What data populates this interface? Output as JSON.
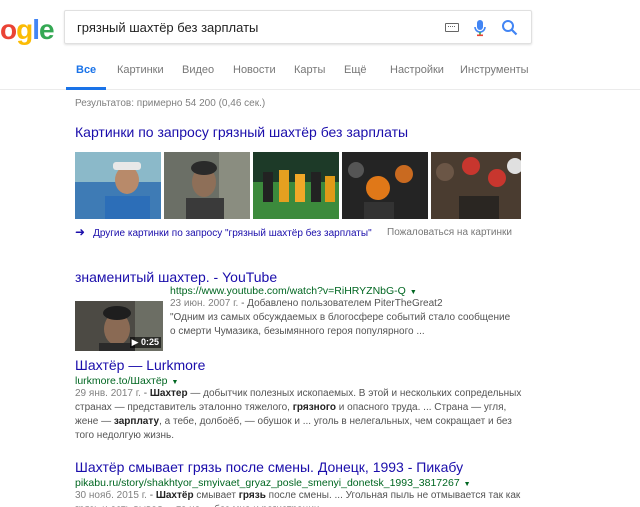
{
  "logo": {
    "letters": [
      "o",
      "g",
      "l",
      "e"
    ],
    "colors": [
      "#EA4335",
      "#FBBC05",
      "#4285F4",
      "#34A853"
    ]
  },
  "search": {
    "query": "грязный шахтёр без зарплаты"
  },
  "tabs": [
    {
      "label": "Все",
      "active": true
    },
    {
      "label": "Картинки"
    },
    {
      "label": "Видео"
    },
    {
      "label": "Новости"
    },
    {
      "label": "Карты"
    },
    {
      "label": "Ещё"
    },
    {
      "label": "Настройки"
    },
    {
      "label": "Инструменты"
    }
  ],
  "stats": "Результатов: примерно 54 200 (0,46 сек.)",
  "images": {
    "title": "Картинки по запросу грязный шахтёр без зарплаты",
    "more_link": "Другие картинки по запросу \"грязный шахтёр без зарплаты\"",
    "report": "Пожаловаться на картинки"
  },
  "results": [
    {
      "title": "знаменитый шахтер. - YouTube",
      "url": "https://www.youtube.com/watch?v=RiHRYZNbG-Q",
      "date": "23 июн. 2007 г.",
      "meta": " - Добавлено пользователем PiterTheGreat2",
      "snippet": "\"Одним из самых обсуждаемых в блогосфере событий стало сообщение о смерти Чумазика, безымянного героя популярного ...",
      "duration": "▶ 0:25"
    },
    {
      "title": "Шахтёр — Lurkmore",
      "url": "lurkmore.to/Шахтёр",
      "date": "29 янв. 2017 г.",
      "s1": " - ",
      "b1": "Шахтер",
      "s2": " — добытчик полезных ископаемых. В этой и нескольких сопредельных странах — представитель эталонно тяжелого, ",
      "b2": "грязного",
      "s3": " и опасного труда. ... Страна — угля, жене — ",
      "b3": "зарплату",
      "s4": ", а тебе, долбоёб, — обушок и ... уголь в нелегальных, чем сокращает и без того недолгую жизнь."
    },
    {
      "title": "Шахтёр смывает грязь после смены. Донецк, 1993 - Пикабу",
      "url": "pikabu.ru/story/shakhtyor_smyivaet_gryaz_posle_smenyi_donetsk_1993_3817267",
      "date": "30 нояб. 2015 г.",
      "s1": " - ",
      "b1": "Шахтёр",
      "s2": " смывает ",
      "b2": "грязь",
      "s3": " после смены. ... Угольная пыль не отмывается так как грязь и есть вывод ... то не ... без мне и регистрации"
    }
  ],
  "colors": {
    "link": "#1a0dab",
    "url": "#006621",
    "accent": "#1a73e8"
  },
  "icons": [
    "keyboard-icon",
    "mic-icon",
    "search-icon",
    "arrow-right-icon",
    "dropdown-arrow-icon",
    "play-icon"
  ]
}
